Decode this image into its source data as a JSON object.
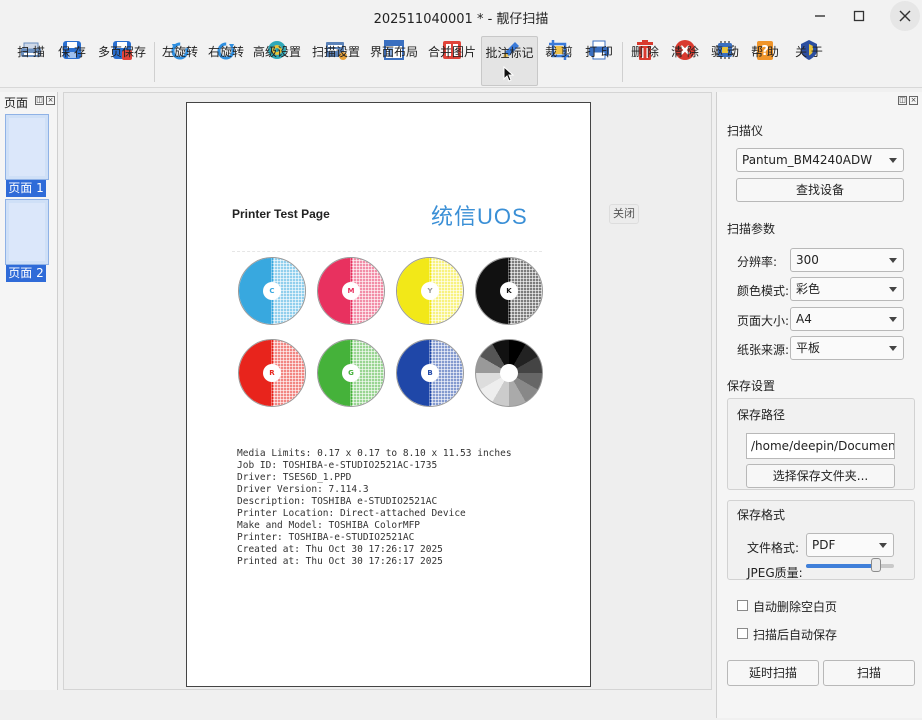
{
  "window": {
    "title": "202511040001 * - 靓仔扫描"
  },
  "toolbar": {
    "items": [
      {
        "label": "扫 描",
        "icon": "scanner-icon"
      },
      {
        "label": "保 存",
        "icon": "save-icon"
      },
      {
        "label": "多页保存",
        "icon": "multi-save-icon"
      },
      {
        "label": "左旋转",
        "icon": "rotate-left-icon"
      },
      {
        "label": "右旋转",
        "icon": "rotate-right-icon"
      },
      {
        "label": "高级设置",
        "icon": "advanced-settings-icon"
      },
      {
        "label": "扫描设置",
        "icon": "scan-settings-icon"
      },
      {
        "label": "界面布局",
        "icon": "layout-icon"
      },
      {
        "label": "合并图片",
        "icon": "merge-icon"
      },
      {
        "label": "批注标记",
        "icon": "pen-icon"
      },
      {
        "label": "裁 剪",
        "icon": "crop-icon"
      },
      {
        "label": "打 印",
        "icon": "printer-icon"
      },
      {
        "label": "删 除",
        "icon": "trash-icon"
      },
      {
        "label": "清 除",
        "icon": "clear-icon"
      },
      {
        "label": "驱 动",
        "icon": "driver-icon"
      },
      {
        "label": "帮 助",
        "icon": "help-icon"
      },
      {
        "label": "关 于",
        "icon": "about-icon"
      }
    ],
    "active": "批注标记"
  },
  "pages_panel": {
    "title": "页面",
    "pages": [
      "页面 1",
      "页面 2"
    ]
  },
  "preview": {
    "close_label": "关闭",
    "doc_title": "Printer Test Page",
    "logo_text": "统信UOS",
    "circles": [
      {
        "letter": "C",
        "color": "#38a8df"
      },
      {
        "letter": "M",
        "color": "#e8315f"
      },
      {
        "letter": "Y",
        "color": "#f2e818"
      },
      {
        "letter": "K",
        "color": "#111111"
      },
      {
        "letter": "R",
        "color": "#e8241c"
      },
      {
        "letter": "G",
        "color": "#45b23a"
      },
      {
        "letter": "B",
        "color": "#1f47a8"
      },
      {
        "letter": "",
        "color": "#808080"
      }
    ],
    "info_lines": [
      "Media Limits: 0.17 x 0.17 to 8.10 x 11.53 inches",
      "Job ID: TOSHIBA-e-STUDIO2521AC-1735",
      "Driver: TSES6D_1.PPD",
      "Driver Version: 7.114.3",
      "Description: TOSHIBA e-STUDIO2521AC",
      "Printer Location: Direct-attached Device",
      "Make and Model: TOSHIBA ColorMFP",
      "Printer: TOSHIBA-e-STUDIO2521AC",
      "Created at: Thu Oct 30 17:26:17 2025",
      "Printed at: Thu Oct 30 17:26:17 2025"
    ]
  },
  "settings": {
    "scanner_section": "扫描仪",
    "scanner_value": "Pantum_BM4240ADW",
    "find_device": "查找设备",
    "params_section": "扫描参数",
    "resolution_label": "分辨率:",
    "resolution_value": "300",
    "color_label": "颜色模式:",
    "color_value": "彩色",
    "size_label": "页面大小:",
    "size_value": "A4",
    "source_label": "纸张来源:",
    "source_value": "平板",
    "save_section": "保存设置",
    "save_path_label": "保存路径",
    "save_path_value": "/home/deepin/Documents",
    "choose_folder": "选择保存文件夹...",
    "save_format_label": "保存格式",
    "file_format_label": "文件格式:",
    "file_format_value": "PDF",
    "jpeg_label": "JPEG质量:",
    "jpeg_quality_fraction": 0.8,
    "auto_delete_blank": "自动删除空白页",
    "auto_save": "扫描后自动保存",
    "delay_scan": "延时扫描",
    "scan": "扫描"
  }
}
